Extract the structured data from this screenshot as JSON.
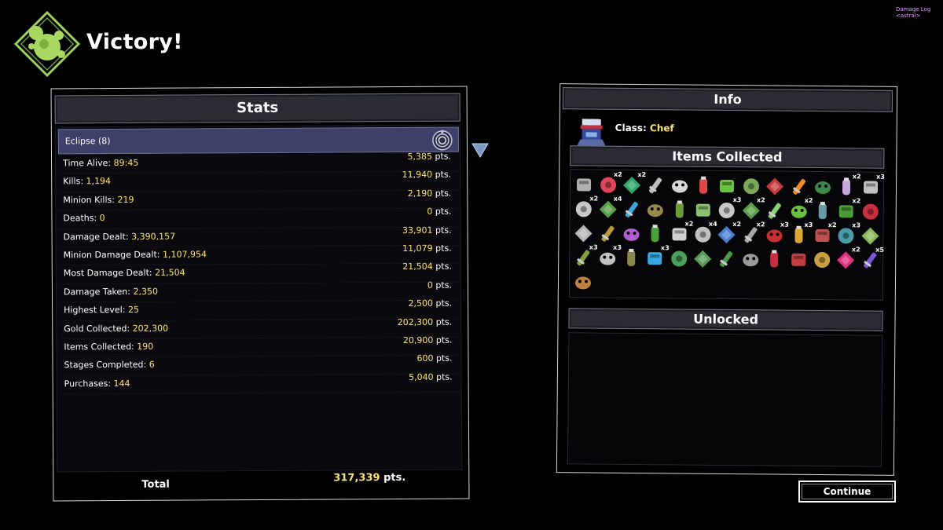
{
  "header": {
    "title": "Victory!"
  },
  "damage_log": {
    "title": "Damage Log",
    "subtitle": "<astral>"
  },
  "stats": {
    "title": "Stats",
    "eclipse_label": "Eclipse (8)",
    "rows": [
      {
        "label": "Time Alive: ",
        "value": "89:45",
        "points": "5,385",
        "unit": " pts."
      },
      {
        "label": "Kills: ",
        "value": "1,194",
        "points": "11,940",
        "unit": " pts."
      },
      {
        "label": "Minion Kills: ",
        "value": "219",
        "points": "2,190",
        "unit": " pts."
      },
      {
        "label": "Deaths: ",
        "value": "0",
        "points": "0",
        "unit": " pts."
      },
      {
        "label": "Damage Dealt: ",
        "value": "3,390,157",
        "points": "33,901",
        "unit": " pts."
      },
      {
        "label": "Minion Damage Dealt: ",
        "value": "1,107,954",
        "points": "11,079",
        "unit": " pts."
      },
      {
        "label": "Most Damage Dealt: ",
        "value": "21,504",
        "points": "21,504",
        "unit": " pts."
      },
      {
        "label": "Damage Taken: ",
        "value": "2,350",
        "points": "0",
        "unit": " pts."
      },
      {
        "label": "Highest Level: ",
        "value": "25",
        "points": "2,500",
        "unit": " pts."
      },
      {
        "label": "Gold Collected: ",
        "value": "202,300",
        "points": "202,300",
        "unit": " pts."
      },
      {
        "label": "Items Collected: ",
        "value": "190",
        "points": "20,900",
        "unit": " pts."
      },
      {
        "label": "Stages Completed: ",
        "value": "6",
        "points": "600",
        "unit": " pts."
      },
      {
        "label": "Purchases: ",
        "value": "144",
        "points": "5,040",
        "unit": " pts."
      }
    ],
    "total_label": "Total",
    "total_value": "317,339",
    "total_unit": " pts."
  },
  "info": {
    "title": "Info",
    "class_label": "Class: ",
    "class_value": "Chef",
    "items_title": "Items Collected",
    "unlocked_title": "Unlocked",
    "items": [
      {
        "icon": "glasses-icon",
        "color": "#b0b0b0",
        "stack": ""
      },
      {
        "icon": "card-icon",
        "color": "#e2465a",
        "stack": "x2"
      },
      {
        "icon": "ring-icon",
        "color": "#2fa86a",
        "stack": "x2"
      },
      {
        "icon": "scroll-icon",
        "color": "#bdbdbd",
        "stack": ""
      },
      {
        "icon": "horns-icon",
        "color": "#d8d8d8",
        "stack": ""
      },
      {
        "icon": "bottle-icon",
        "color": "#e04848",
        "stack": ""
      },
      {
        "icon": "leaf-icon",
        "color": "#6ac043",
        "stack": ""
      },
      {
        "icon": "canister-icon",
        "color": "#7da85a",
        "stack": ""
      },
      {
        "icon": "cap-icon",
        "color": "#c43c3c",
        "stack": ""
      },
      {
        "icon": "magnifier-icon",
        "color": "#f08a2a",
        "stack": ""
      },
      {
        "icon": "tablet-icon",
        "color": "#3c8a4a",
        "stack": ""
      },
      {
        "icon": "guitar-icon",
        "color": "#c8a8d8",
        "stack": "x2"
      },
      {
        "icon": "dagger-icon",
        "color": "#c0c0c0",
        "stack": "x3"
      },
      {
        "icon": "sword-icon",
        "color": "#c8c8c8",
        "stack": "x2"
      },
      {
        "icon": "leaves-icon",
        "color": "#5aa04a",
        "stack": "x4"
      },
      {
        "icon": "feather-icon",
        "color": "#3aa8d8",
        "stack": ""
      },
      {
        "icon": "mask-icon",
        "color": "#9a8a4a",
        "stack": ""
      },
      {
        "icon": "shell-icon",
        "color": "#6a9a3a",
        "stack": ""
      },
      {
        "icon": "mushroom-icon",
        "color": "#8ac070",
        "stack": ""
      },
      {
        "icon": "boot-icon",
        "color": "#c8c8c8",
        "stack": "x3"
      },
      {
        "icon": "claw-icon",
        "color": "#5aa04a",
        "stack": "x2"
      },
      {
        "icon": "syringe-icon",
        "color": "#8ad070",
        "stack": ""
      },
      {
        "icon": "fang-icon",
        "color": "#6ac043",
        "stack": "x2"
      },
      {
        "icon": "teapot-icon",
        "color": "#6a9aa8",
        "stack": ""
      },
      {
        "icon": "snake-icon",
        "color": "#4a9a3a",
        "stack": "x2"
      },
      {
        "icon": "orb-icon",
        "color": "#c83040",
        "stack": ""
      },
      {
        "icon": "wrap-icon",
        "color": "#b8b8b8",
        "stack": ""
      },
      {
        "icon": "helmet-icon",
        "color": "#b89a3a",
        "stack": ""
      },
      {
        "icon": "crystal-icon",
        "color": "#b060d0",
        "stack": ""
      },
      {
        "icon": "spiral-icon",
        "color": "#4aa03a",
        "stack": ""
      },
      {
        "icon": "bones-icon",
        "color": "#d0d0d0",
        "stack": "x2"
      },
      {
        "icon": "wings-icon",
        "color": "#c0c0c0",
        "stack": "x4"
      },
      {
        "icon": "cube-icon",
        "color": "#4a80d0",
        "stack": "x2"
      },
      {
        "icon": "hammer-icon",
        "color": "#a8a8a8",
        "stack": "x2"
      },
      {
        "icon": "book-icon",
        "color": "#c83030",
        "stack": "x3"
      },
      {
        "icon": "coin-icon",
        "color": "#d8a830",
        "stack": "x3"
      },
      {
        "icon": "chest-icon",
        "color": "#c05050",
        "stack": "x2"
      },
      {
        "icon": "boomerang-icon",
        "color": "#4a9aa8",
        "stack": "x3"
      },
      {
        "icon": "blade-icon",
        "color": "#8ab858",
        "stack": ""
      },
      {
        "icon": "frog-icon",
        "color": "#8aa040",
        "stack": "x3"
      },
      {
        "icon": "mug-icon",
        "color": "#c0c0c0",
        "stack": "x3"
      },
      {
        "icon": "cheese-icon",
        "color": "#8a8a4a",
        "stack": ""
      },
      {
        "icon": "vial-icon",
        "color": "#3aa8e0",
        "stack": "x3"
      },
      {
        "icon": "pick-icon",
        "color": "#4aa05a",
        "stack": ""
      },
      {
        "icon": "hook-icon",
        "color": "#5a9a5a",
        "stack": ""
      },
      {
        "icon": "loop-icon",
        "color": "#4a9a4a",
        "stack": ""
      },
      {
        "icon": "chain-icon",
        "color": "#9a9a9a",
        "stack": ""
      },
      {
        "icon": "heart-icon",
        "color": "#c83040",
        "stack": ""
      },
      {
        "icon": "crab-icon",
        "color": "#c04040",
        "stack": ""
      },
      {
        "icon": "seed-icon",
        "color": "#c8a040",
        "stack": ""
      },
      {
        "icon": "potion-icon",
        "color": "#e03080",
        "stack": "x2"
      },
      {
        "icon": "grapes-icon",
        "color": "#7a5ad8",
        "stack": "x5"
      },
      {
        "icon": "doll-icon",
        "color": "#c08040",
        "stack": ""
      }
    ]
  },
  "continue_label": "Continue"
}
